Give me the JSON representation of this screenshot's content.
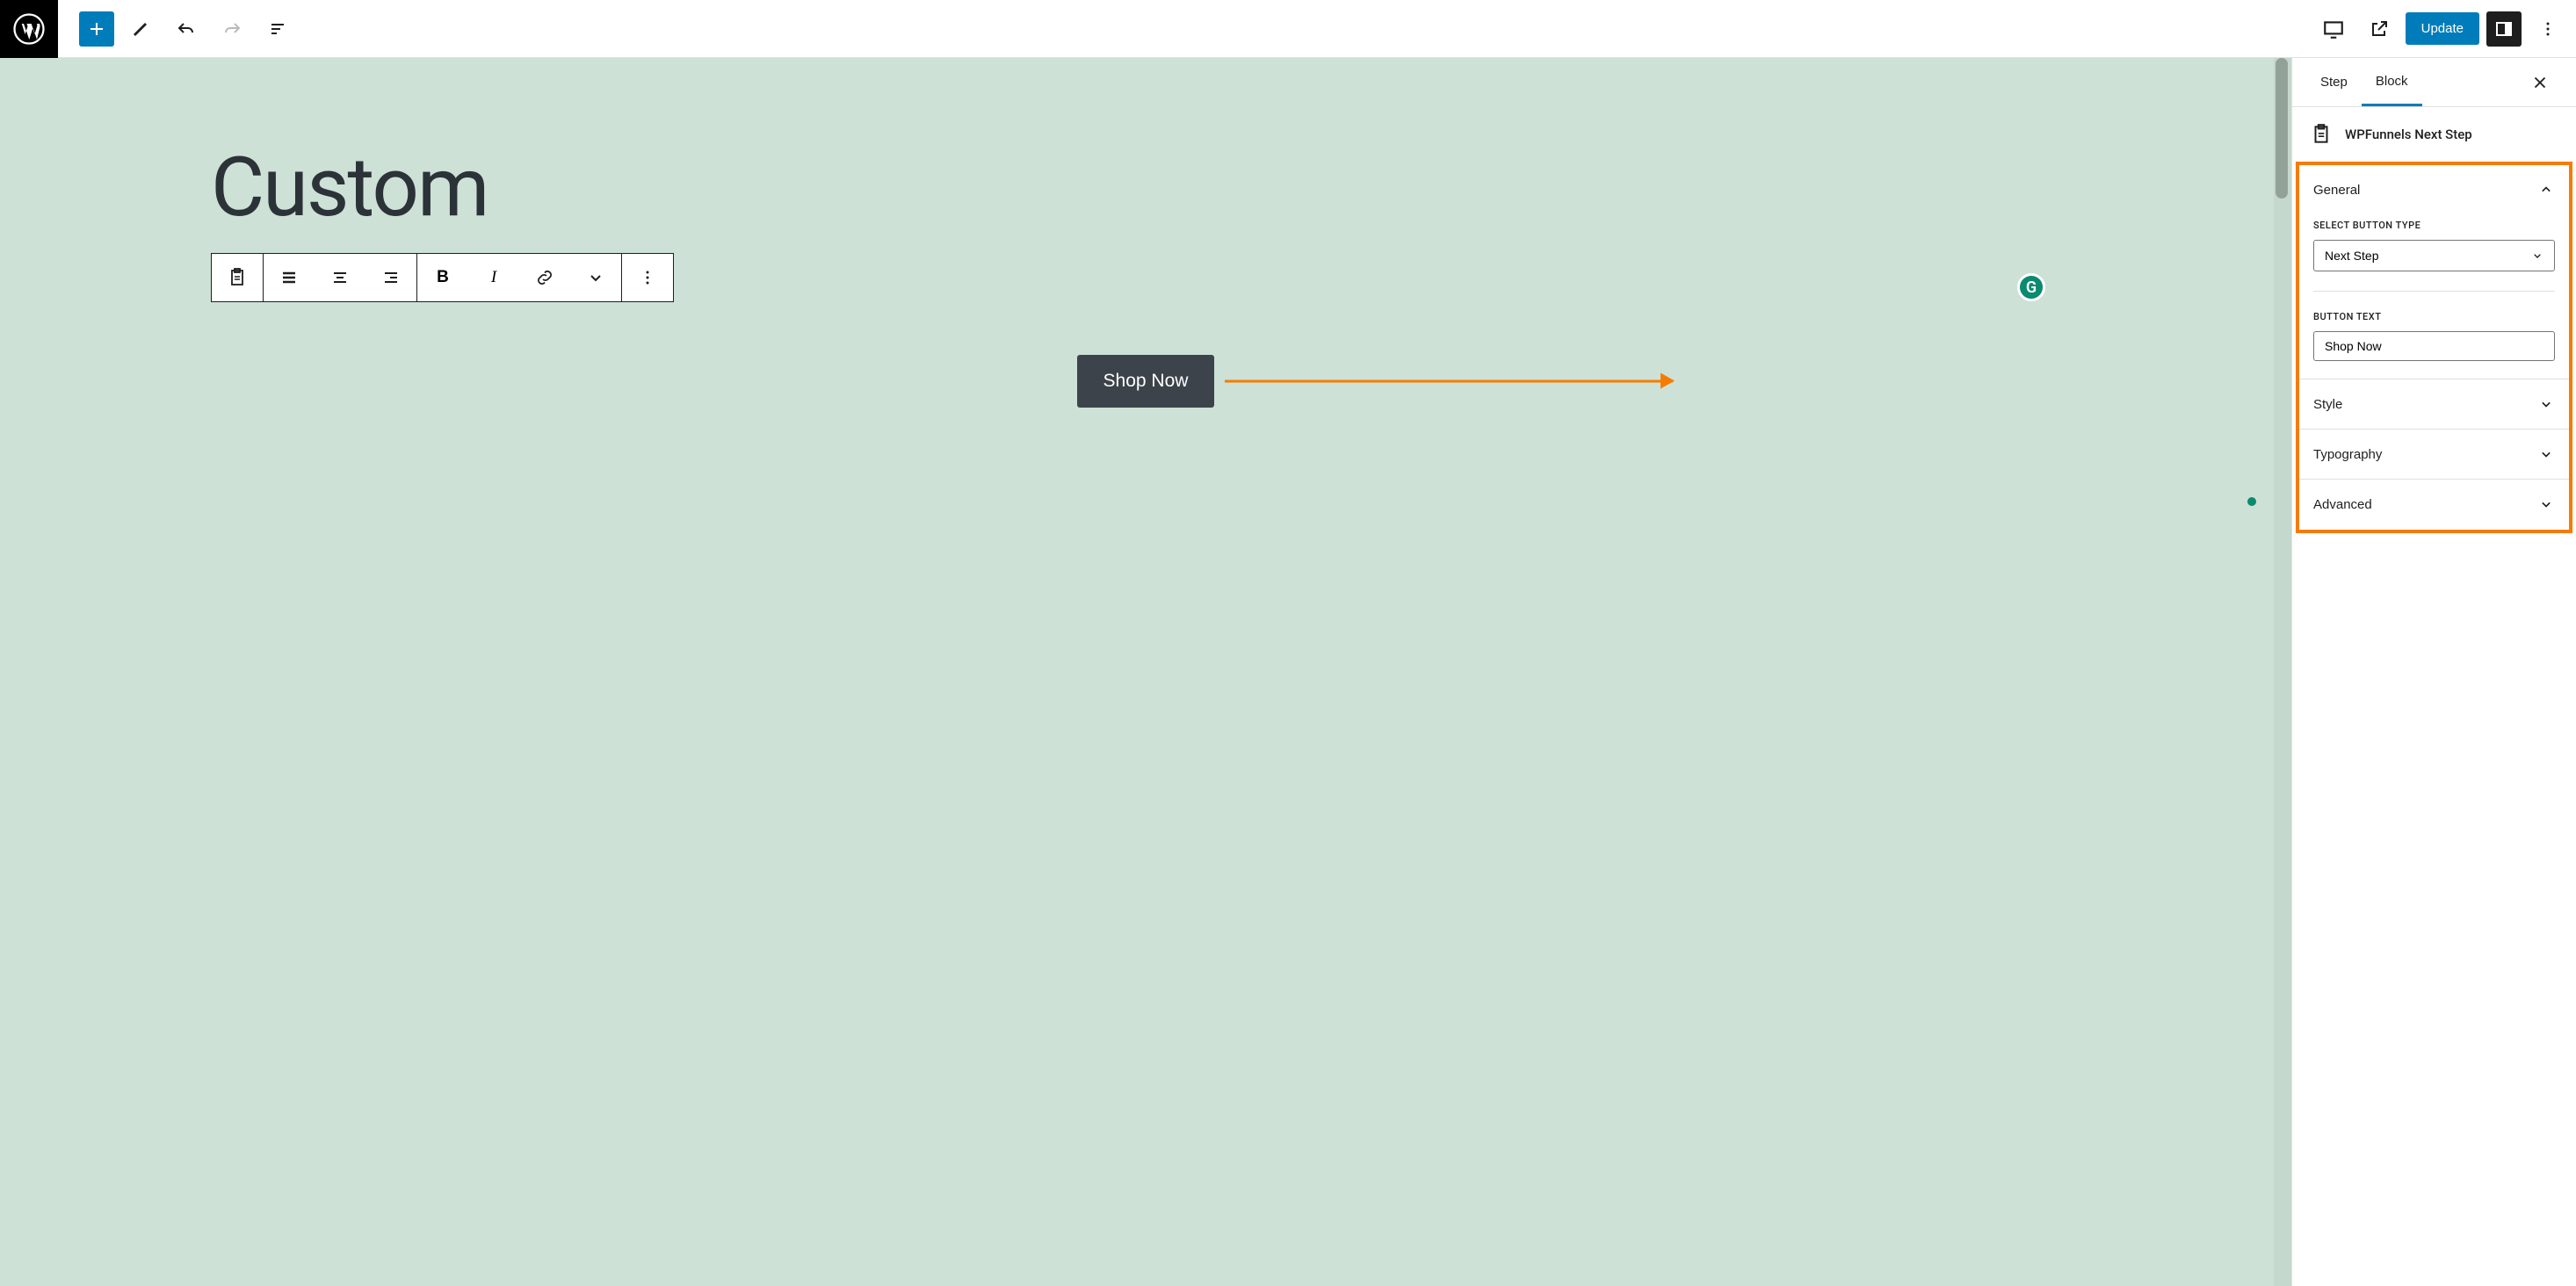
{
  "toolbar": {
    "update_label": "Update"
  },
  "canvas": {
    "page_title": "Custom",
    "shop_button_label": "Shop Now"
  },
  "sidebar": {
    "tabs": {
      "step": "Step",
      "block": "Block"
    },
    "block_name": "WPFunnels Next Step",
    "sections": {
      "general": {
        "title": "General",
        "type_label": "Select Button Type",
        "type_value": "Next Step",
        "text_label": "Button Text",
        "text_value": "Shop Now"
      },
      "style": "Style",
      "typography": "Typography",
      "advanced": "Advanced"
    }
  }
}
